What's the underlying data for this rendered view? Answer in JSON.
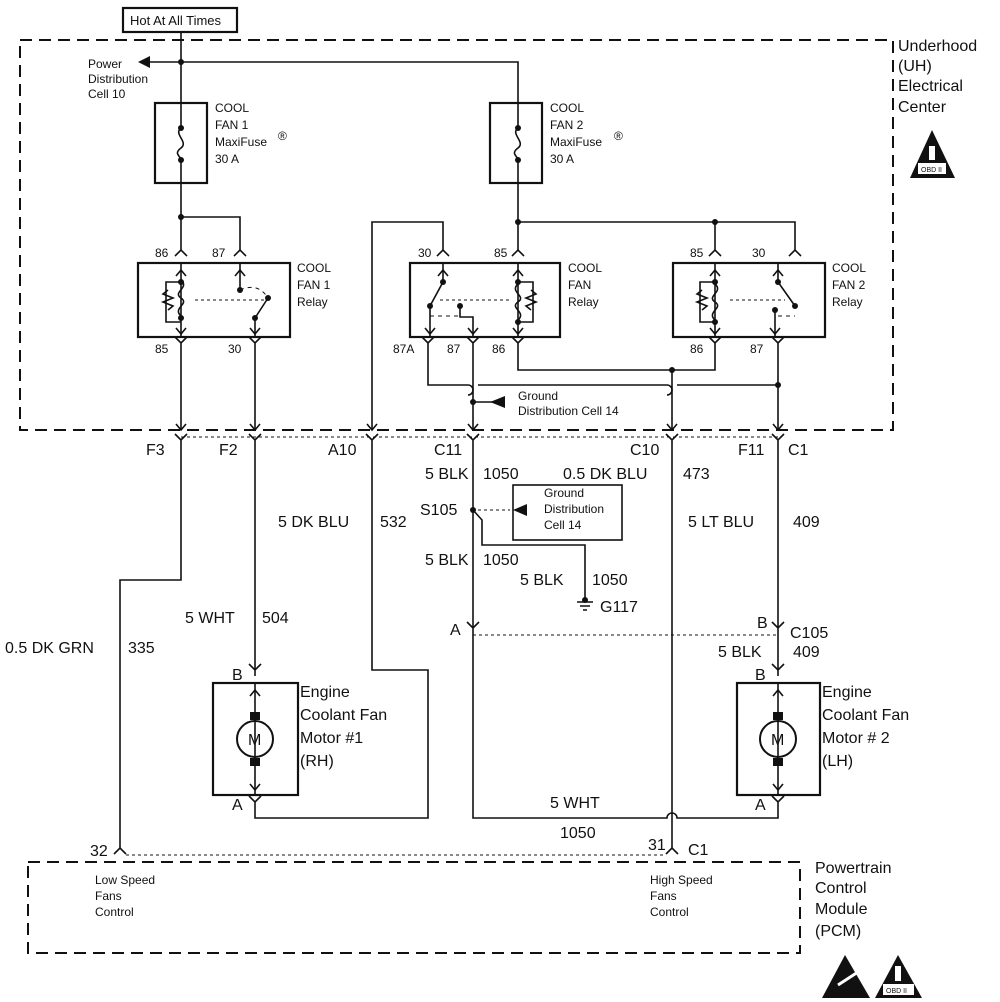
{
  "power_source": "Hot At All Times",
  "uh_center": {
    "lines": [
      "Underhood",
      "(UH)",
      "Electrical",
      "Center"
    ],
    "badge": "OBD II"
  },
  "power_distribution": [
    "Power",
    "Distribution",
    "Cell 10"
  ],
  "fuse1": {
    "lines": [
      "COOL",
      "FAN 1",
      "MaxiFuse",
      "30 A"
    ],
    "mark": "®"
  },
  "fuse2": {
    "lines": [
      "COOL",
      "FAN 2",
      "MaxiFuse",
      "30 A"
    ],
    "mark": "®"
  },
  "relay1": {
    "lines": [
      "COOL",
      "FAN 1",
      "Relay"
    ],
    "pins": {
      "top_left": "86",
      "top_right": "87",
      "bottom_left": "85",
      "bottom_right": "30"
    }
  },
  "relay_main": {
    "lines": [
      "COOL",
      "FAN",
      "Relay"
    ],
    "pins": {
      "top_left": "30",
      "top_right": "85",
      "bottom_a": "87A",
      "bottom_b": "87",
      "bottom_c": "86"
    }
  },
  "relay2": {
    "lines": [
      "COOL",
      "FAN 2",
      "Relay"
    ],
    "pins": {
      "top_left": "85",
      "top_right": "30",
      "bottom_left": "86",
      "bottom_right": "87"
    }
  },
  "ground_cell_inner": [
    "Ground",
    "Distribution Cell 14"
  ],
  "connectors": {
    "f3": "F3",
    "f2": "F2",
    "a10": "A10",
    "c11": "C11",
    "c10": "C10",
    "f11": "F11",
    "c1": "C1"
  },
  "wires": {
    "w335": {
      "color": "0.5 DK GRN",
      "circuit": "335"
    },
    "w504": {
      "color": "5 WHT",
      "circuit": "504"
    },
    "w532": {
      "color": "5 DK BLU",
      "circuit": "532"
    },
    "w1050a": {
      "color": "5 BLK",
      "circuit": "1050"
    },
    "w1050b": {
      "color": "5 BLK",
      "circuit": "1050"
    },
    "w1050c": {
      "color": "5 BLK",
      "circuit": "1050"
    },
    "w473": {
      "color": "0.5 DK BLU",
      "circuit": "473"
    },
    "w409a": {
      "color": "5 LT BLU",
      "circuit": "409"
    },
    "w409b": {
      "color": "5 BLK",
      "circuit": "409"
    },
    "w1050d": {
      "color": "5 WHT",
      "circuit": "1050"
    }
  },
  "splice": "S105",
  "ground_box": [
    "Ground",
    "Distribution",
    "Cell 14"
  ],
  "ground": "G117",
  "c105": {
    "name": "C105",
    "pin_left": "A",
    "pin_right": "B"
  },
  "motor1": {
    "lines": [
      "Engine",
      "Coolant Fan",
      "Motor #1",
      "(RH)"
    ],
    "pin_top": "B",
    "pin_bottom": "A",
    "symbol": "M"
  },
  "motor2": {
    "lines": [
      "Engine",
      "Coolant Fan",
      "Motor # 2",
      "(LH)"
    ],
    "pin_top": "B",
    "pin_bottom": "A",
    "symbol": "M"
  },
  "pcm": {
    "lines": [
      "Powertrain",
      "Control",
      "Module",
      "(PCM)"
    ],
    "pin_low": "32",
    "pin_high": "31",
    "connector": "C1",
    "low": [
      "Low Speed",
      "Fans",
      "Control"
    ],
    "high": [
      "High Speed",
      "Fans",
      "Control"
    ]
  },
  "footer_icons": [
    "esd-sensitive-icon",
    "obd-ii-icon"
  ],
  "footer_badge": "OBD II"
}
